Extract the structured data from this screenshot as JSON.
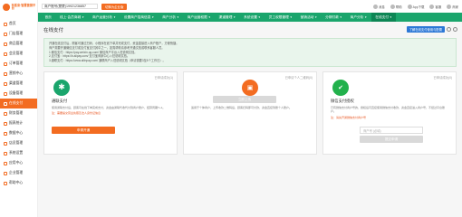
{
  "logo": {
    "text": "有客来·智慧营销平台"
  },
  "sidebar": {
    "items": [
      {
        "label": "首页"
      },
      {
        "label": "门店管理"
      },
      {
        "label": "商品管理"
      },
      {
        "label": "会员管理"
      },
      {
        "label": "订单管理"
      },
      {
        "label": "营销中心"
      },
      {
        "label": "渠道管理"
      },
      {
        "label": "设备管理"
      },
      {
        "label": "在线支付"
      },
      {
        "label": "财务管理"
      },
      {
        "label": "报表统计"
      },
      {
        "label": "数据中心"
      },
      {
        "label": "店员管理"
      },
      {
        "label": "系统设置"
      },
      {
        "label": "应用中心"
      },
      {
        "label": "企业管理"
      },
      {
        "label": "帮助中心"
      }
    ]
  },
  "topbar": {
    "phone_value": "商户账号(蒙蒙)19921236857",
    "switch_label": "切换为企业版",
    "right_items": [
      "消息",
      "帮助",
      "App下载",
      "客服",
      "商家"
    ]
  },
  "nav": {
    "items": [
      "首页",
      "线上·会员商城",
      "商户运营分析",
      "设置商户招商信息",
      "商户分析",
      "商户运营权限",
      "渠道管理",
      "系统设置",
      "员工权限管理",
      "营销活动",
      "分期付款",
      "商户分析",
      "在线支付"
    ]
  },
  "page": {
    "title": "在线支付",
    "help_button": "了解在线支付使用与配置",
    "notice_lines": [
      "开通在线支付后，顾客可通过扫码、小程序在线下单并完成支付，资金直接进入商户账户，方便快捷。",
      "商户需要开通微信支付或支付宝支付其中之一，如需帮助请参考开通文档或联系客服人员。",
      "1.微信支付：https://pay.weixin.qq.com/ 微信商户平台入驻说明文档。",
      "2.支付宝：https://b.alipay.com/ 支付宝商家中心入驻说明文档。",
      "3.通联支付：https://www.allinpay.com/ 通联商户入驻说明文档（申请需要3至5个工作日）。"
    ]
  },
  "cards": [
    {
      "tag": "已申请成功(1)",
      "title": "通联支付",
      "desc": "使用通联支付后，顾客可在线下单完成支付，资金由通联代收代付到商户账户，结算周期T+1。",
      "warn": "注：需要提交营业执照及法人身份证信息",
      "button": "申请开通"
    },
    {
      "tag": "已申请个人二维码(0)",
      "title": "个人二维码收款",
      "desc": "适用于个体商户，上传收款二维码后，顾客扫码即可付款，资金直接到账个人账户。",
      "button": "立即上传"
    },
    {
      "tag": "已申请成功(0)",
      "title": "微信支付授权",
      "desc": "已有微信支付商户号的，授权后可直接使用微信支付收款，资金直接进入商户号，不经过平台账户。",
      "warn": "注：请先开通微信支付商户号",
      "input_placeholder": "商户号 (必填)",
      "button": "提交申请"
    }
  ]
}
